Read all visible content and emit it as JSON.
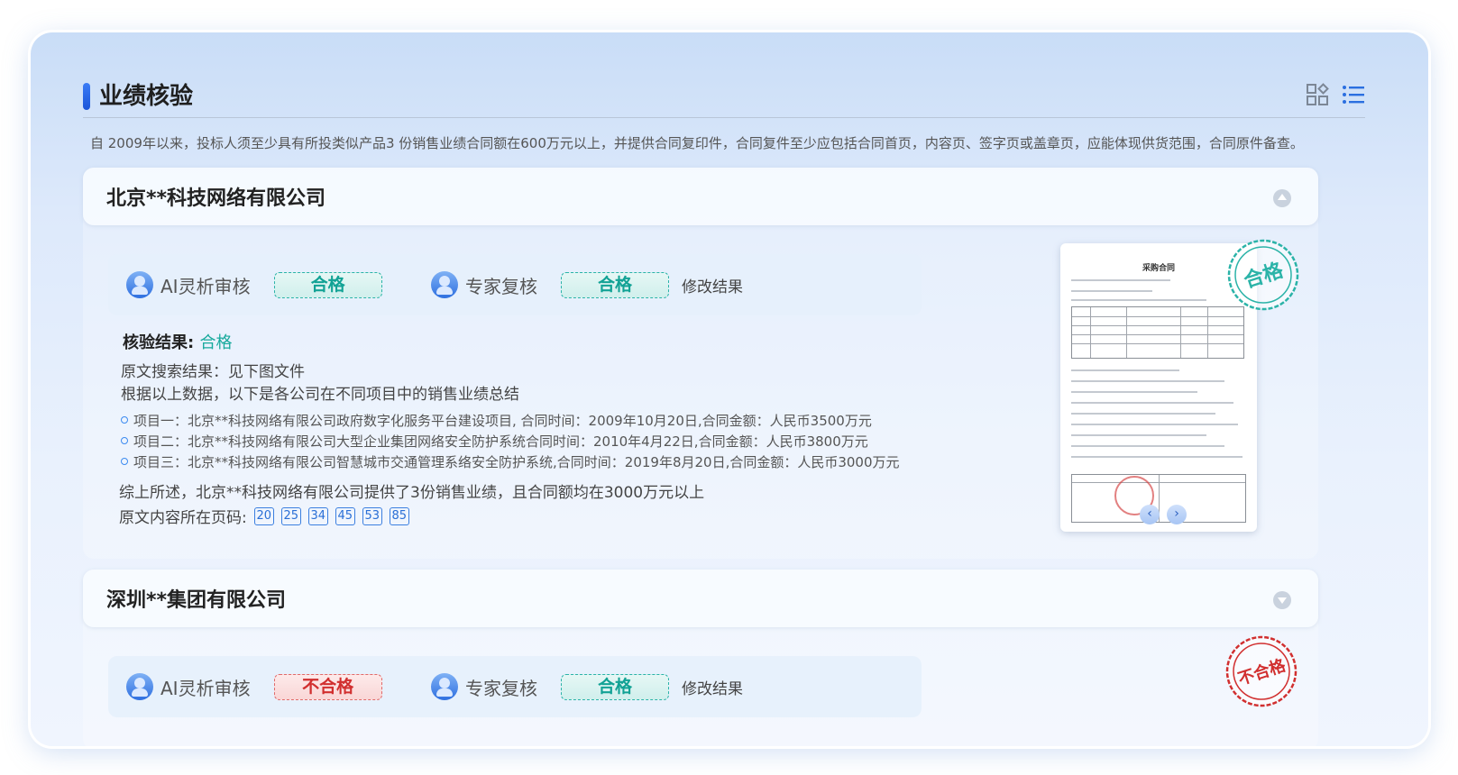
{
  "section": {
    "title": "业绩核验",
    "description": "自 2009年以来，投标人须至少具有所投类似产品3 份销售业绩合同额在600万元以上，并提供合同复印件，合同复件至少应包括合同首页，内容页、签字页或盖章页，应能体现供货范围，合同原件备查。",
    "view_icons": [
      "grid-view-icon",
      "list-view-icon"
    ]
  },
  "companies": [
    {
      "name": "北京**科技网络有限公司",
      "ai_label": "AI灵析审核",
      "ai_result": "合格",
      "expert_label": "专家复核",
      "expert_result": "合格",
      "modify_label": "修改结果",
      "result_title": "核验结果:",
      "result_value": "合格",
      "search_result": "原文搜索结果：见下图文件",
      "summary_intro": "根据以上数据，以下是各公司在不同项目中的销售业绩总结",
      "items": [
        "项目一：北京**科技网络有限公司政府数字化服务平台建设项目, 合同时间：2009年10月20日,合同金额：人民币3500万元",
        "项目二：北京**科技网络有限公司大型企业集团网络安全防护系统合同时间：2010年4月22日,合同金额：人民币3800万元",
        "项目三：北京**科技网络有限公司智慧城市交通管理系络安全防护系统,合同时间：2019年8月20日,合同金额：人民币3000万元"
      ],
      "conclusion": "综上所述，北京**科技网络有限公司提供了3份销售业绩，且合同额均在3000万元以上",
      "pages_label": "原文内容所在页码:",
      "pages": [
        "20",
        "25",
        "34",
        "45",
        "53",
        "85"
      ],
      "doc_title": "采购合同",
      "stamp_text": "合格",
      "stamp_color": "#2bb3a8"
    },
    {
      "name": "深圳**集团有限公司",
      "ai_label": "AI灵析审核",
      "ai_result": "不合格",
      "expert_label": "专家复核",
      "expert_result": "合格",
      "modify_label": "修改结果",
      "stamp_text": "不合格",
      "stamp_color": "#d12f2f"
    }
  ],
  "colors": {
    "accent": "#2b6fe0",
    "pass": "#12a295",
    "fail": "#d12f2f"
  }
}
